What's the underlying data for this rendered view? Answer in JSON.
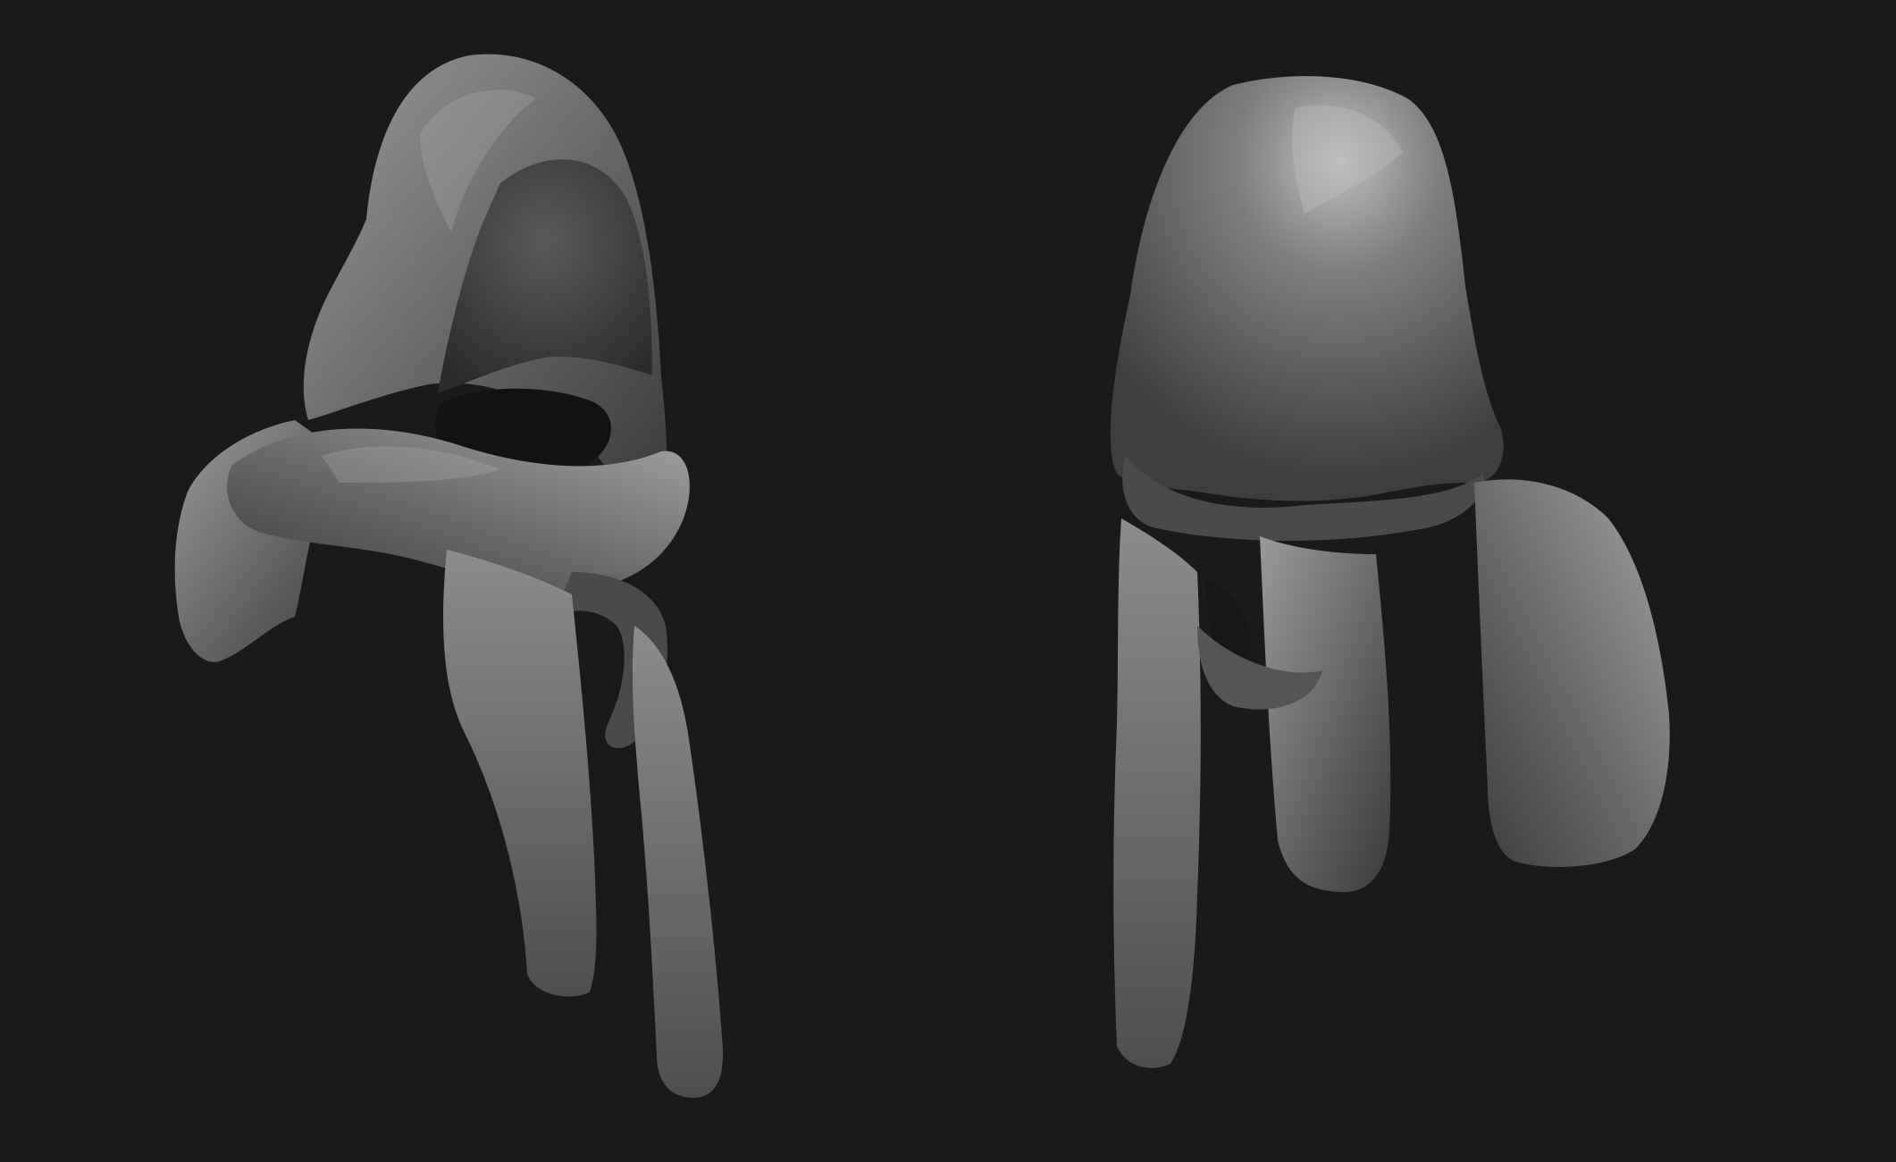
{
  "scene": {
    "background_color": "#1a1a1a",
    "material_colors": {
      "base": "#6e6e6e",
      "highlight": "#b6b6b6",
      "shadow": "#2c2c2c",
      "inner": "#0e0e0e"
    },
    "models": [
      {
        "id": "hooded-scarf-front",
        "view": "front"
      },
      {
        "id": "hooded-scarf-back",
        "view": "back"
      }
    ]
  }
}
